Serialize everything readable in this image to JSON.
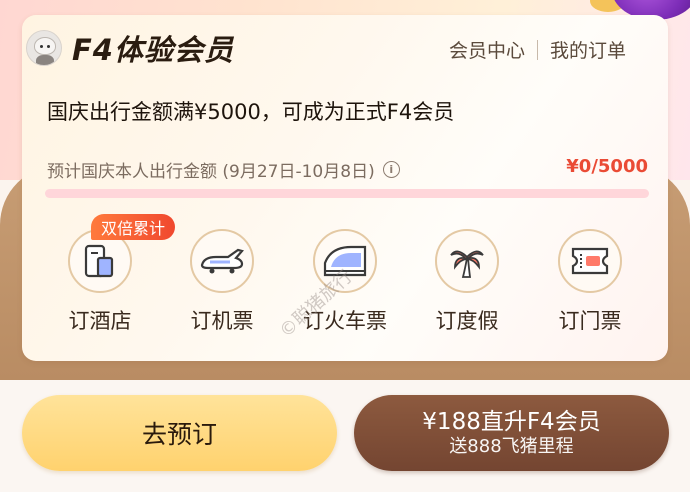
{
  "header": {
    "title": "F4体验会员",
    "links": [
      "会员中心",
      "我的订单"
    ]
  },
  "subtitle": "国庆出行金额满¥5000，可成为正式F4会员",
  "progress": {
    "label": "预计国庆本人出行金额 (9月27日-10月8日)",
    "value_text": "¥0/5000",
    "fraction": 0.0
  },
  "badge": "双倍累计",
  "services": [
    {
      "label": "订酒店",
      "icon": "hotel-icon"
    },
    {
      "label": "订机票",
      "icon": "plane-icon"
    },
    {
      "label": "订火车票",
      "icon": "train-icon"
    },
    {
      "label": "订度假",
      "icon": "palm-tree-icon"
    },
    {
      "label": "订门票",
      "icon": "ticket-icon"
    }
  ],
  "watermark": "©聪猪旅行",
  "buttons": {
    "book": "去预订",
    "upgrade_main": "¥188直升F4会员",
    "upgrade_sub": "送888飞猪里程"
  },
  "colors": {
    "accent_red": "#ea4b35",
    "brown": "#744531",
    "gold": "#ffd26e"
  }
}
